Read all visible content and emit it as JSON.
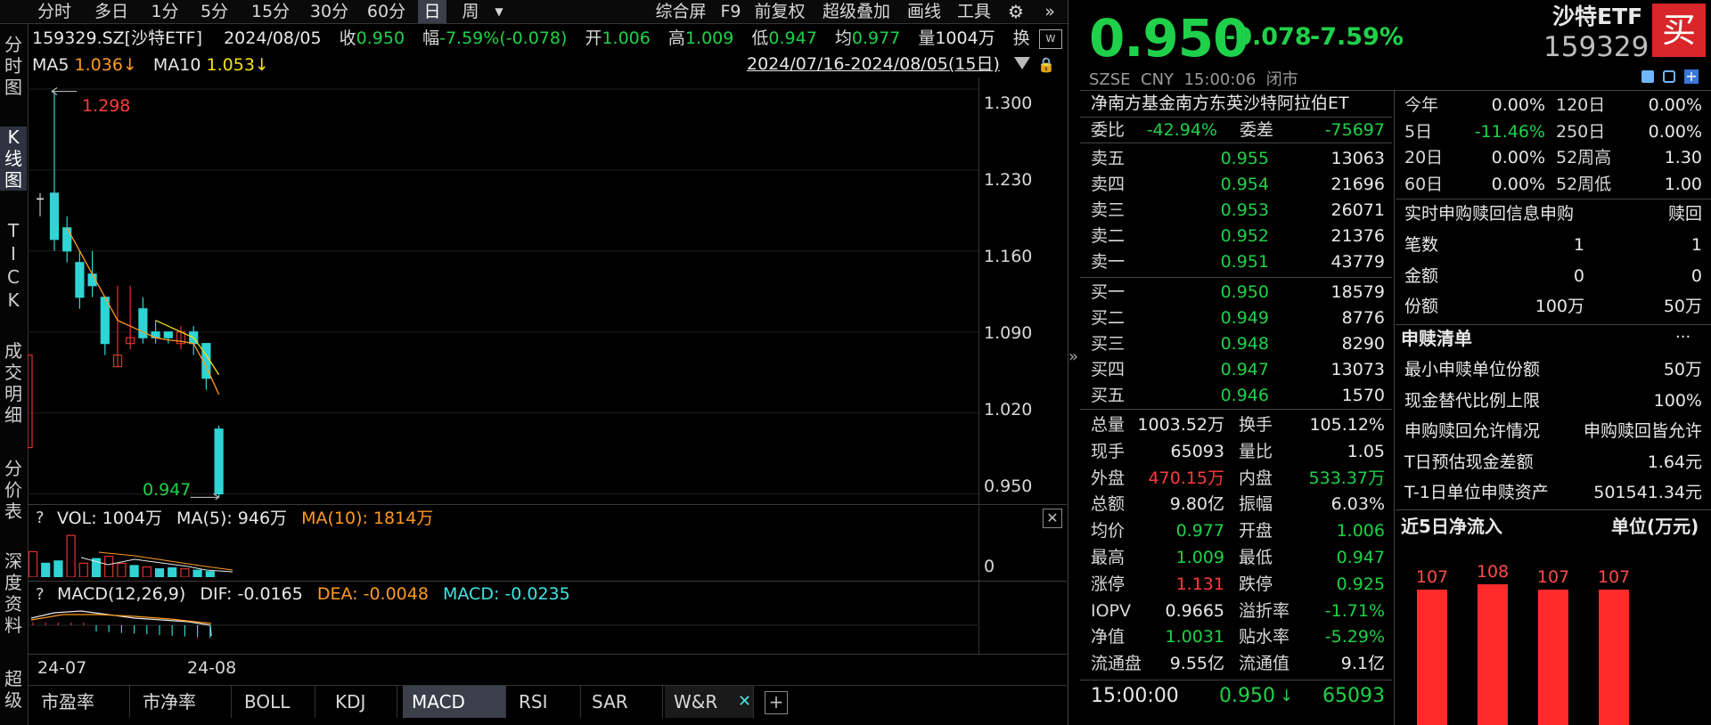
{
  "toolbar": {
    "periods": [
      "分时",
      "多日",
      "1分",
      "5分",
      "15分",
      "30分",
      "60分",
      "日",
      "周"
    ],
    "active_period": "日",
    "dropdown_icon": "caret-down",
    "right_items": [
      "综合屏",
      "F9",
      "前复权",
      "超级叠加",
      "画线",
      "工具"
    ],
    "gear_icon": "gear",
    "more_icon": "double-chevron-right"
  },
  "side_tabs": [
    "分时图",
    "K线图",
    "TICK",
    "成交明细",
    "分价表",
    "深度资料",
    "超级"
  ],
  "info_bar": {
    "code": "159329.SZ[沙特ETF]",
    "date": "2024/08/05",
    "close_label": "收",
    "close": "0.950",
    "change_label": "幅",
    "change": "-7.59%(-0.078)",
    "open_label": "开",
    "open": "1.006",
    "high_label": "高",
    "high": "1.009",
    "low_label": "低",
    "low": "0.947",
    "avg_label": "均",
    "avg": "0.977",
    "vol_label": "量",
    "vol": "1004万",
    "turn_label": "换"
  },
  "ma_bar": {
    "ma5_label": "MA5",
    "ma5": "1.036↓",
    "ma10_label": "MA10",
    "ma10": "1.053↓",
    "range": "2024/07/16-2024/08/05(15日)"
  },
  "price_axis": [
    "1.300",
    "1.230",
    "1.160",
    "1.090",
    "1.020",
    "0.950"
  ],
  "annotations": {
    "max": "1.298",
    "min": "0.947"
  },
  "chart_data": {
    "type": "candlestick",
    "ylim": [
      0.945,
      1.31
    ],
    "candles": [
      {
        "o": 1.21,
        "h": 1.298,
        "l": 1.16,
        "c": 1.17
      },
      {
        "o": 1.18,
        "h": 1.19,
        "l": 1.15,
        "c": 1.16
      },
      {
        "o": 1.15,
        "h": 1.16,
        "l": 1.11,
        "c": 1.12
      },
      {
        "o": 1.14,
        "h": 1.16,
        "l": 1.12,
        "c": 1.13
      },
      {
        "o": 1.12,
        "h": 1.12,
        "l": 1.07,
        "c": 1.08
      },
      {
        "o": 1.06,
        "h": 1.13,
        "l": 1.06,
        "c": 1.07
      },
      {
        "o": 1.08,
        "h": 1.13,
        "l": 1.075,
        "c": 1.085
      },
      {
        "o": 1.11,
        "h": 1.12,
        "l": 1.08,
        "c": 1.085
      },
      {
        "o": 1.09,
        "h": 1.1,
        "l": 1.08,
        "c": 1.085
      },
      {
        "o": 1.09,
        "h": 1.09,
        "l": 1.08,
        "c": 1.085
      },
      {
        "o": 1.08,
        "h": 1.095,
        "l": 1.075,
        "c": 1.09
      },
      {
        "o": 1.09,
        "h": 1.095,
        "l": 1.07,
        "c": 1.08
      },
      {
        "o": 1.08,
        "h": 1.08,
        "l": 1.04,
        "c": 1.05
      },
      {
        "o": 1.006,
        "h": 1.009,
        "l": 0.947,
        "c": 0.95
      }
    ],
    "ma5": [
      1.18,
      1.16,
      1.14,
      1.12,
      1.1,
      1.095,
      1.09,
      1.085,
      1.083,
      1.082,
      1.08,
      1.06,
      1.036
    ],
    "ma10": [
      1.1,
      1.095,
      1.09,
      1.085,
      1.07,
      1.053
    ]
  },
  "volume": {
    "label": "VOL: 1004万",
    "ma5": "MA(5): 946万",
    "ma10": "MA(10): 1814万",
    "axis_zero": "0",
    "help": "?",
    "close_icon": "close-x",
    "bars": [
      0.55,
      0.3,
      0.35,
      0.9,
      0.3,
      0.4,
      0.45,
      0.3,
      0.25,
      0.22,
      0.18,
      0.2,
      0.18,
      0.15,
      0.12
    ]
  },
  "macd": {
    "label": "MACD(12,26,9)",
    "dif": "DIF: -0.0165",
    "dea": "DEA: -0.0048",
    "macd": "MACD: -0.0235",
    "help": "?"
  },
  "date_axis": [
    "24-07",
    "24-08"
  ],
  "bottom_tabs": [
    "市盈率",
    "市净率",
    "BOLL",
    "KDJ",
    "MACD",
    "RSI",
    "SAR",
    "W&R"
  ],
  "active_bottom_tab": "MACD",
  "right_panel": {
    "price": "0.950",
    "change": "-0.078",
    "change_pct": "-7.59%",
    "name": "沙特ETF",
    "code": "159329",
    "buy_label": "买",
    "exchange_line": "SZSE  CNY  15:00:06  闭市",
    "icons": [
      "edit-icon",
      "bell-icon",
      "add-icon"
    ],
    "fund_name": "净南方基金南方东英沙特阿拉伯ET",
    "weibi_label": "委比",
    "weibi": "-42.94%",
    "weicha_label": "委差",
    "weicha": "-75697",
    "asks": [
      {
        "label": "卖五",
        "price": "0.955",
        "vol": "13063"
      },
      {
        "label": "卖四",
        "price": "0.954",
        "vol": "21696"
      },
      {
        "label": "卖三",
        "price": "0.953",
        "vol": "26071"
      },
      {
        "label": "卖二",
        "price": "0.952",
        "vol": "21376"
      },
      {
        "label": "卖一",
        "price": "0.951",
        "vol": "43779"
      }
    ],
    "bids": [
      {
        "label": "买一",
        "price": "0.950",
        "vol": "18579"
      },
      {
        "label": "买二",
        "price": "0.949",
        "vol": "8776"
      },
      {
        "label": "买三",
        "price": "0.948",
        "vol": "8290"
      },
      {
        "label": "买四",
        "price": "0.947",
        "vol": "13073"
      },
      {
        "label": "买五",
        "price": "0.946",
        "vol": "1570"
      }
    ],
    "stats": [
      {
        "l1": "总量",
        "v1": "1003.52万",
        "c1": "white",
        "l2": "换手",
        "v2": "105.12%",
        "c2": "white"
      },
      {
        "l1": "现手",
        "v1": "65093",
        "c1": "white",
        "l2": "量比",
        "v2": "1.05",
        "c2": "white"
      },
      {
        "l1": "外盘",
        "v1": "470.15万",
        "c1": "red",
        "l2": "内盘",
        "v2": "533.37万",
        "c2": "green"
      },
      {
        "l1": "总额",
        "v1": "9.80亿",
        "c1": "white",
        "l2": "振幅",
        "v2": "6.03%",
        "c2": "white"
      },
      {
        "l1": "均价",
        "v1": "0.977",
        "c1": "green",
        "l2": "开盘",
        "v2": "1.006",
        "c2": "green"
      },
      {
        "l1": "最高",
        "v1": "1.009",
        "c1": "green",
        "l2": "最低",
        "v2": "0.947",
        "c2": "green"
      },
      {
        "l1": "涨停",
        "v1": "1.131",
        "c1": "red",
        "l2": "跌停",
        "v2": "0.925",
        "c2": "green"
      },
      {
        "l1": "IOPV",
        "v1": "0.9665",
        "c1": "white",
        "l2": "溢折率",
        "v2": "-1.71%",
        "c2": "green"
      },
      {
        "l1": "净值",
        "v1": "1.0031",
        "c1": "green",
        "l2": "贴水率",
        "v2": "-5.29%",
        "c2": "green"
      },
      {
        "l1": "流通盘",
        "v1": "9.55亿",
        "c1": "white",
        "l2": "流通值",
        "v2": "9.1亿",
        "c2": "white"
      }
    ],
    "last_trade": {
      "time": "15:00:00",
      "price": "0.950",
      "arrow": "↓",
      "vol": "65093"
    }
  },
  "far_right": {
    "perf": [
      {
        "l1": "今年",
        "v1": "0.00%",
        "c1": "white",
        "l2": "120日",
        "v2": "0.00%"
      },
      {
        "l1": "5日",
        "v1": "-11.46%",
        "c1": "green",
        "l2": "250日",
        "v2": "0.00%"
      },
      {
        "l1": "20日",
        "v1": "0.00%",
        "c1": "white",
        "l2": "52周高",
        "v2": "1.30"
      },
      {
        "l1": "60日",
        "v1": "0.00%",
        "c1": "white",
        "l2": "52周低",
        "v2": "1.00"
      }
    ],
    "realtime_title": "实时申购赎回信息申购",
    "redeem_label": "赎回",
    "realtime_rows": [
      {
        "l": "笔数",
        "a": "1",
        "b": "1"
      },
      {
        "l": "金额",
        "a": "0",
        "b": "0"
      },
      {
        "l": "份额",
        "a": "100万",
        "b": "50万"
      }
    ],
    "list_title": "申赎清单",
    "more": "···",
    "list_rows": [
      {
        "l": "最小申赎单位份额",
        "v": "50万"
      },
      {
        "l": "现金替代比例上限",
        "v": "100%"
      },
      {
        "l": "申购赎回允许情况",
        "v": "申购赎回皆允许"
      },
      {
        "l": "T日预估现金差额",
        "v": "1.64元"
      },
      {
        "l": "T-1日单位申赎资产",
        "v": "501541.34元"
      }
    ],
    "inflow_title": "近5日净流入",
    "inflow_unit": "单位(万元)",
    "inflow_values": [
      107,
      108,
      107,
      107
    ]
  }
}
